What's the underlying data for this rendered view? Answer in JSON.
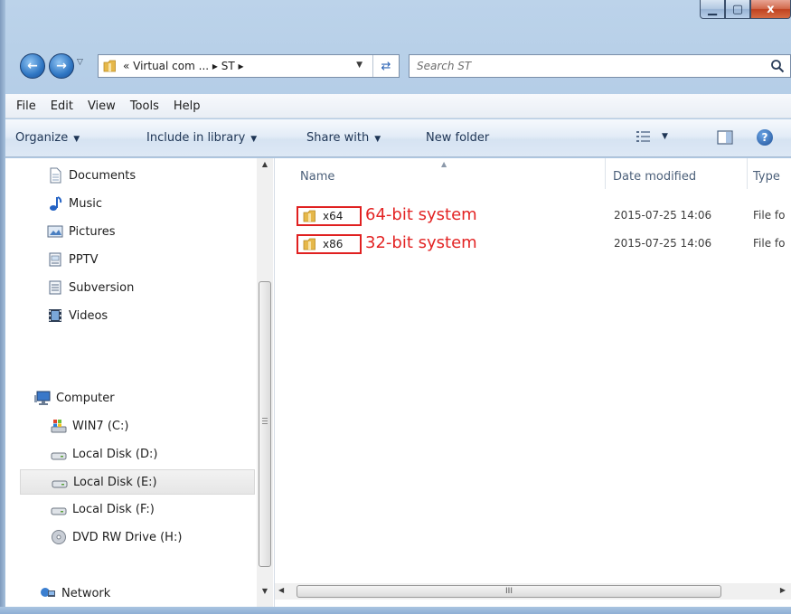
{
  "window": {
    "minimize_glyph": "▁",
    "maximize_glyph": "▢",
    "close_glyph": "x"
  },
  "address": {
    "path": "« Virtual com ... ▸ ST ▸",
    "search_placeholder": "Search ST"
  },
  "menu": [
    "File",
    "Edit",
    "View",
    "Tools",
    "Help"
  ],
  "toolbar": {
    "organize": "Organize",
    "include": "Include in library",
    "share": "Share with",
    "new_folder": "New folder"
  },
  "nav": {
    "documents": "Documents",
    "music": "Music",
    "pictures": "Pictures",
    "pptv": "PPTV",
    "subversion": "Subversion",
    "videos": "Videos",
    "computer": "Computer",
    "win7": "WIN7 (C:)",
    "local_d": "Local Disk (D:)",
    "local_e": "Local Disk (E:)",
    "local_f": "Local Disk (F:)",
    "dvd": "DVD RW Drive (H:)",
    "network": "Network",
    "selected": "Local Disk (E:)"
  },
  "columns": {
    "name": "Name",
    "date": "Date modified",
    "type": "Type"
  },
  "files": [
    {
      "name": "x64",
      "annotation": "64-bit system",
      "date": "2015-07-25 14:06",
      "type": "File fo"
    },
    {
      "name": "x86",
      "annotation": "32-bit system",
      "date": "2015-07-25 14:06",
      "type": "File fo"
    }
  ],
  "hscroll_grip": "III",
  "colors": {
    "annotation_red": "#e32424",
    "frame_blue": "#a9c5e2",
    "close_red": "#c04220"
  },
  "icons": [
    "back-arrow-icon",
    "forward-arrow-icon",
    "folder-icon",
    "refresh-icon",
    "search-icon",
    "view-options-icon",
    "preview-pane-icon",
    "help-icon",
    "documents-icon",
    "music-icon",
    "pictures-icon",
    "library-icon",
    "video-icon",
    "computer-icon",
    "drive-icon",
    "dvd-icon",
    "network-icon"
  ]
}
